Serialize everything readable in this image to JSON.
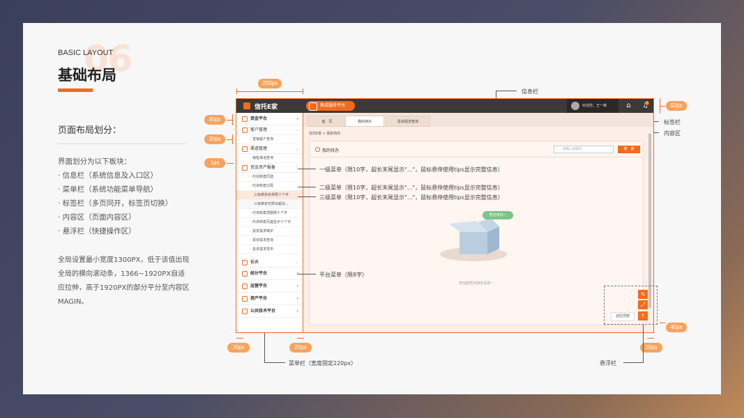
{
  "left": {
    "big_number": "06",
    "eyebrow": "BASIC LAYOUT",
    "title": "基础布局",
    "subtitle": "页面布局划分：",
    "intro": "界面划分为以下板块：",
    "bullets": [
      "· 信息栏（系统信息及入口区）",
      "· 菜单栏（系统功能菜单导航）",
      "· 标签栏（多页同开，标签页切换）",
      "· 内容区（页面内容区）",
      "· 悬浮栏（快捷操作区）"
    ],
    "note": "全局设置最小宽度1300PX，低于该值出现全局的横向滚动条，1366~1920PX自适应拉伸，高于1920PX的部分平分至内容区MAGIN。"
  },
  "dims": {
    "w220": "220px",
    "h40": "40px",
    "h30": "30px",
    "h1": "1px",
    "right50": "50px",
    "right40": "40px",
    "b20a": "20px",
    "b20b": "20px",
    "b20c": "20px"
  },
  "annotations": {
    "info_bar": "信息栏",
    "tab_bar": "标签栏",
    "content_area": "内容区",
    "level1": "一级菜单（限10字，超长末尾显示\"...\"，鼠标悬停使用tips显示完整信息）",
    "level2": "二级菜单（限10字，超长末尾显示\"...\"，鼠标悬停使用tips显示完整信息）",
    "level3": "三级菜单（限10字，超长末尾显示\"...\"，鼠标悬停使用tips显示完整信息）",
    "platform_menu": "平台菜单（限8字）",
    "menu_bar": "菜单栏（宽度固定220px）",
    "float_bar": "悬浮栏"
  },
  "mock": {
    "logo": "信托E家",
    "platform": "集成服务平台",
    "user": "欢迎您，王一峰",
    "bell_count": "9",
    "sidebar": {
      "platform1": "资金平台",
      "m1": "客户管理",
      "m1s1": "· 直销客户查询",
      "m2": "渠道管理",
      "m2s1": "· 销售渠道查询",
      "m3": "资金资产报备",
      "m3s1": "· 约资新案同选",
      "m3s2": "· 约资新案分配",
      "m3s3": "三级菜单名称限十个字",
      "m3s4": "三级菜单无限出超出...",
      "m3s5": "· 约资新案调整限十个字",
      "m3s6": "· 约资新案页面显示十个字",
      "m3s7": "· 投资需求维护",
      "m3s8": "· 投资需求查询",
      "m3s9": "· 投资需求发布",
      "m4": "报表",
      "platform2": "经分平台",
      "platform3": "运营平台",
      "platform4": "资产平台",
      "platform5": "公共技术平台"
    },
    "tabs": [
      "首　页",
      "我的待办",
      "投资需求查询"
    ],
    "crumb": "信托E家  >  我的待办",
    "panel_title": "我的待办",
    "search_placeholder": "请输入关键词",
    "search_btn": "搜　索",
    "empty_bubble": "暂无待办~",
    "empty_text": "您当前暂无待办信息~",
    "back_top": "返回顶部"
  }
}
